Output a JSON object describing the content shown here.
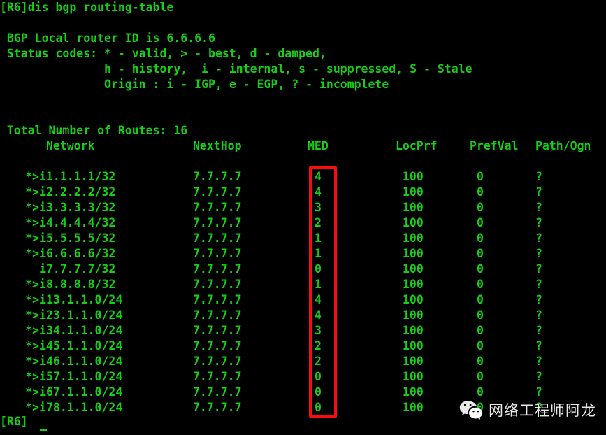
{
  "terminal": {
    "prompt_command": "[R6]dis bgp routing-table",
    "router_id_line": " BGP Local router ID is 6.6.6.6",
    "status_codes_line": " Status codes: * - valid, > - best, d - damped,",
    "status_codes_line2": "               h - history,  i - internal, s - suppressed, S - Stale",
    "origin_line": "               Origin : i - IGP, e - EGP, ? - incomplete",
    "total_routes_line": " Total Number of Routes: 16",
    "end_prompt": "[R6]",
    "text_color": "#14d014",
    "background_color": "#000000"
  },
  "table": {
    "headers": {
      "network": "Network",
      "nexthop": "NextHop",
      "med": "MED",
      "locprf": "LocPrf",
      "prefval": "PrefVal",
      "path": "Path/Ogn"
    },
    "rows": [
      {
        "status": "*>i",
        "network": "1.1.1.1/32",
        "nexthop": "7.7.7.7",
        "med": "4",
        "locprf": "100",
        "prefval": "0",
        "path": "?"
      },
      {
        "status": "*>i",
        "network": "2.2.2.2/32",
        "nexthop": "7.7.7.7",
        "med": "4",
        "locprf": "100",
        "prefval": "0",
        "path": "?"
      },
      {
        "status": "*>i",
        "network": "3.3.3.3/32",
        "nexthop": "7.7.7.7",
        "med": "3",
        "locprf": "100",
        "prefval": "0",
        "path": "?"
      },
      {
        "status": "*>i",
        "network": "4.4.4.4/32",
        "nexthop": "7.7.7.7",
        "med": "2",
        "locprf": "100",
        "prefval": "0",
        "path": "?"
      },
      {
        "status": "*>i",
        "network": "5.5.5.5/32",
        "nexthop": "7.7.7.7",
        "med": "1",
        "locprf": "100",
        "prefval": "0",
        "path": "?"
      },
      {
        "status": "*>i",
        "network": "6.6.6.6/32",
        "nexthop": "7.7.7.7",
        "med": "1",
        "locprf": "100",
        "prefval": "0",
        "path": "?"
      },
      {
        "status": "i",
        "network": "7.7.7.7/32",
        "nexthop": "7.7.7.7",
        "med": "0",
        "locprf": "100",
        "prefval": "0",
        "path": "?"
      },
      {
        "status": "*>i",
        "network": "8.8.8.8/32",
        "nexthop": "7.7.7.7",
        "med": "1",
        "locprf": "100",
        "prefval": "0",
        "path": "?"
      },
      {
        "status": "*>i",
        "network": "13.1.1.0/24",
        "nexthop": "7.7.7.7",
        "med": "4",
        "locprf": "100",
        "prefval": "0",
        "path": "?"
      },
      {
        "status": "*>i",
        "network": "23.1.1.0/24",
        "nexthop": "7.7.7.7",
        "med": "4",
        "locprf": "100",
        "prefval": "0",
        "path": "?"
      },
      {
        "status": "*>i",
        "network": "34.1.1.0/24",
        "nexthop": "7.7.7.7",
        "med": "3",
        "locprf": "100",
        "prefval": "0",
        "path": "?"
      },
      {
        "status": "*>i",
        "network": "45.1.1.0/24",
        "nexthop": "7.7.7.7",
        "med": "2",
        "locprf": "100",
        "prefval": "0",
        "path": "?"
      },
      {
        "status": "*>i",
        "network": "46.1.1.0/24",
        "nexthop": "7.7.7.7",
        "med": "2",
        "locprf": "100",
        "prefval": "0",
        "path": "?"
      },
      {
        "status": "*>i",
        "network": "57.1.1.0/24",
        "nexthop": "7.7.7.7",
        "med": "0",
        "locprf": "100",
        "prefval": "0",
        "path": "?"
      },
      {
        "status": "*>i",
        "network": "67.1.1.0/24",
        "nexthop": "7.7.7.7",
        "med": "0",
        "locprf": "100",
        "prefval": "0",
        "path": "?"
      },
      {
        "status": "*>i",
        "network": "78.1.1.0/24",
        "nexthop": "7.7.7.7",
        "med": "0",
        "locprf": "100",
        "prefval": "0",
        "path": "?"
      }
    ]
  },
  "annotation": {
    "target_column": "MED",
    "color": "#fb0b0b"
  },
  "watermark": {
    "icon": "wechat-icon",
    "text": "网络工程师阿龙",
    "color": "#e8e8e8"
  }
}
